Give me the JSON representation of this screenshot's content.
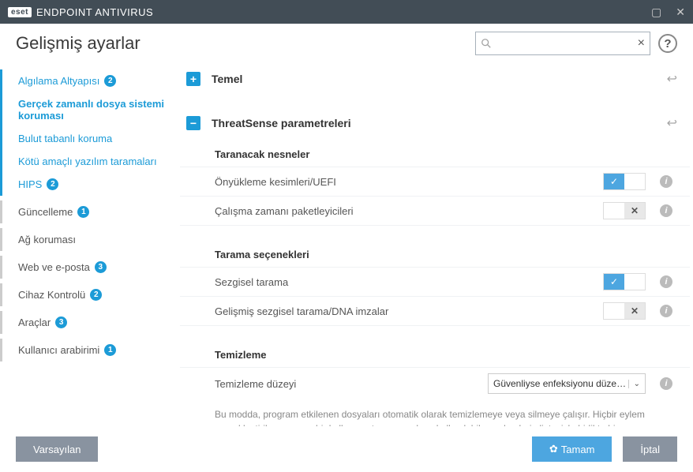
{
  "window": {
    "brand_short": "eset",
    "brand_rest": "ENDPOINT ANTIVIRUS"
  },
  "page": {
    "title": "Gelişmiş ayarlar",
    "search_placeholder": ""
  },
  "sidebar": {
    "items": [
      {
        "label": "Algılama Altyapısı",
        "badge": "2",
        "top": true
      },
      {
        "label": "Gerçek zamanlı dosya sistemi koruması",
        "active": true,
        "top": true
      },
      {
        "label": "Bulut tabanlı koruma",
        "top": true
      },
      {
        "label": "Kötü amaçlı yazılım taramaları",
        "top": true
      },
      {
        "label": "HIPS",
        "badge": "2",
        "top": true
      },
      {
        "label": "Güncelleme",
        "badge": "1",
        "section": true
      },
      {
        "label": "Ağ koruması",
        "section": true
      },
      {
        "label": "Web ve e-posta",
        "badge": "3",
        "section": true
      },
      {
        "label": "Cihaz Kontrolü",
        "badge": "2",
        "section": true
      },
      {
        "label": "Araçlar",
        "badge": "3",
        "section": true
      },
      {
        "label": "Kullanıcı arabirimi",
        "badge": "1",
        "section": true
      }
    ]
  },
  "panels": {
    "basic": {
      "title": "Temel",
      "collapsed": true
    },
    "threatsense": {
      "title": "ThreatSense parametreleri",
      "section_objects": "Taranacak nesneler",
      "row_boot": "Önyükleme kesimleri/UEFI",
      "row_runtime": "Çalışma zamanı paketleyicileri",
      "section_options": "Tarama seçenekleri",
      "row_heuristic": "Sezgisel tarama",
      "row_adv_heuristic": "Gelişmiş sezgisel tarama/DNA imzalar",
      "section_clean": "Temizleme",
      "row_clean_level": "Temizleme düzeyi",
      "clean_value": "Güvenliyse enfeksiyonu düzelt...",
      "clean_desc": "Bu modda, program etkilenen dosyaları otomatik olarak temizlemeye veya silmeye çalışır. Hiçbir eylem gerçekleştirilemezse ve bir kullanıcı oturumu açıksa, kullanılabilen eylemlerin listesiyle birlikte bir uyarı penceresi görüntülenebilir. Uyarı penceresi, eylem başarısız olduğunda da görüntülenir."
    }
  },
  "toggles": {
    "boot": true,
    "runtime": false,
    "heuristic": true,
    "adv_heuristic": false
  },
  "footer": {
    "default": "Varsayılan",
    "ok": "Tamam",
    "cancel": "İptal"
  }
}
